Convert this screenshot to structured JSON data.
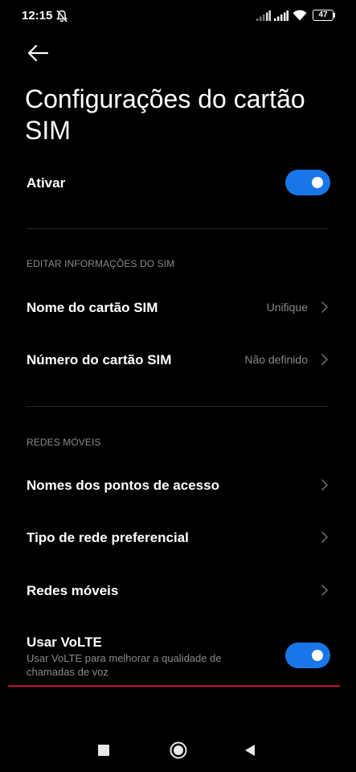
{
  "status_bar": {
    "time": "12:15",
    "battery": "47"
  },
  "header": {
    "title": "Configurações do cartão SIM"
  },
  "activate": {
    "label": "Ativar",
    "enabled": true
  },
  "sections": {
    "sim_info": {
      "title": "EDITAR INFORMAÇÕES DO SIM",
      "items": [
        {
          "label": "Nome do cartão SIM",
          "value": "Unifique"
        },
        {
          "label": "Número do cartão SIM",
          "value": "Não definido"
        }
      ]
    },
    "mobile_networks": {
      "title": "REDES MÓVEIS",
      "items": [
        {
          "label": "Nomes dos pontos de acesso"
        },
        {
          "label": "Tipo de rede preferencial"
        },
        {
          "label": "Redes móveis"
        }
      ]
    }
  },
  "volte": {
    "label": "Usar VoLTE",
    "description": "Usar VoLTE para melhorar a qualidade de chamadas de voz",
    "enabled": true
  },
  "colors": {
    "background": "#000000",
    "accent": "#1976e8",
    "secondary_text": "#8a8a8a",
    "annotation": "#c8102e"
  },
  "icons": [
    "bell-off-icon",
    "signal-icon",
    "wifi-icon",
    "battery-icon",
    "back-arrow-icon",
    "chevron-right-icon",
    "nav-recents-icon",
    "nav-home-icon",
    "nav-back-icon"
  ]
}
